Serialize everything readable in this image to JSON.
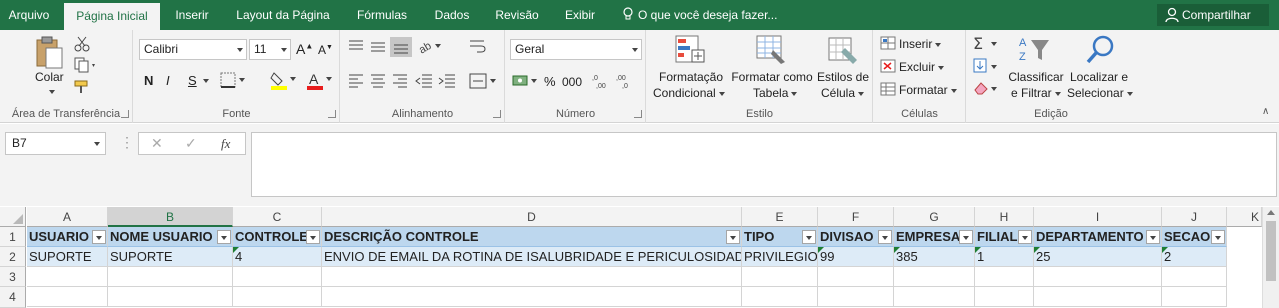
{
  "tabs": [
    "Arquivo",
    "Página Inicial",
    "Inserir",
    "Layout da Página",
    "Fórmulas",
    "Dados",
    "Revisão",
    "Exibir"
  ],
  "tell_me": "O que você deseja fazer...",
  "share_label": "Compartilhar",
  "ribbon": {
    "clipboard": {
      "paste": "Colar",
      "label": "Área de Transferência"
    },
    "font": {
      "name": "Calibri",
      "size": "11",
      "bold": "N",
      "italic": "I",
      "underline": "S",
      "label": "Fonte"
    },
    "alignment": {
      "label": "Alinhamento"
    },
    "number": {
      "format": "Geral",
      "percent": "%",
      "thousands": "000",
      "label": "Número"
    },
    "styles": {
      "conditional_1": "Formatação",
      "conditional_2": "Condicional",
      "table_1": "Formatar como",
      "table_2": "Tabela",
      "cell_1": "Estilos de",
      "cell_2": "Célula",
      "label": "Estilo"
    },
    "cells": {
      "insert": "Inserir",
      "delete": "Excluir",
      "format": "Formatar",
      "label": "Células"
    },
    "editing": {
      "sort_1": "Classificar",
      "sort_2": "e Filtrar",
      "find_1": "Localizar e",
      "find_2": "Selecionar",
      "label": "Edição"
    }
  },
  "formula_bar": {
    "name_box": "B7",
    "fx": "fx",
    "formula": ""
  },
  "columns": [
    "A",
    "B",
    "C",
    "D",
    "E",
    "F",
    "G",
    "H",
    "I",
    "J",
    "K"
  ],
  "rows": [
    "1",
    "2",
    "3",
    "4"
  ],
  "header_row": [
    "USUARIO",
    "NOME USUARIO",
    "CONTROLE",
    "DESCRIÇÃO CONTROLE",
    "TIPO",
    "DIVISAO",
    "EMPRESA",
    "FILIAL",
    "DEPARTAMENTO",
    "SECAO"
  ],
  "data_row": [
    "SUPORTE",
    "SUPORTE",
    "4",
    "ENVIO DE EMAIL DA ROTINA DE ISALUBRIDADE E PERICULOSIDADE",
    "PRIVILEGIO",
    "99",
    "385",
    "1",
    "25",
    "2"
  ],
  "colors": {
    "excel_green": "#217346",
    "header_fill": "#bdd7ee",
    "row_fill": "#ddebf7"
  }
}
